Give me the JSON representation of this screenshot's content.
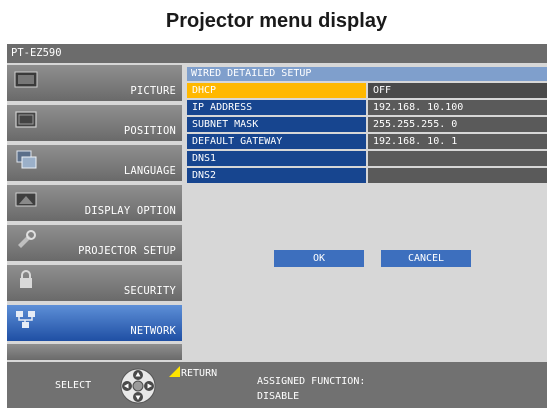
{
  "heading": "Projector menu display",
  "model": "PT-EZ590",
  "menu": {
    "items": [
      {
        "label": "PICTURE",
        "icon": "picture-icon"
      },
      {
        "label": "POSITION",
        "icon": "position-icon"
      },
      {
        "label": "LANGUAGE",
        "icon": "language-icon"
      },
      {
        "label": "DISPLAY OPTION",
        "icon": "display-option-icon"
      },
      {
        "label": "PROJECTOR SETUP",
        "icon": "projector-setup-icon"
      },
      {
        "label": "SECURITY",
        "icon": "lock-icon"
      },
      {
        "label": "NETWORK",
        "icon": "network-icon"
      }
    ],
    "active": "NETWORK"
  },
  "panel": {
    "title": "WIRED DETAILED SETUP",
    "rows": [
      {
        "label": "DHCP",
        "value": "OFF"
      },
      {
        "label": "IP ADDRESS",
        "value": "192.168. 10.100"
      },
      {
        "label": "SUBNET MASK",
        "value": "255.255.255.  0"
      },
      {
        "label": "DEFAULT GATEWAY",
        "value": "192.168. 10.  1"
      },
      {
        "label": "DNS1",
        "value": ""
      },
      {
        "label": "DNS2",
        "value": ""
      }
    ],
    "selected_row": "DHCP",
    "ok_label": "OK",
    "cancel_label": "CANCEL"
  },
  "footer": {
    "select_label": "SELECT",
    "return_label": "RETURN",
    "assigned_line1": "ASSIGNED FUNCTION:",
    "assigned_line2": "DISABLE"
  },
  "colors": {
    "menu_active": "#2a5db0",
    "selected_row": "#ffb800",
    "row_label": "#17458f",
    "title_bar": "#7f9fcc"
  }
}
